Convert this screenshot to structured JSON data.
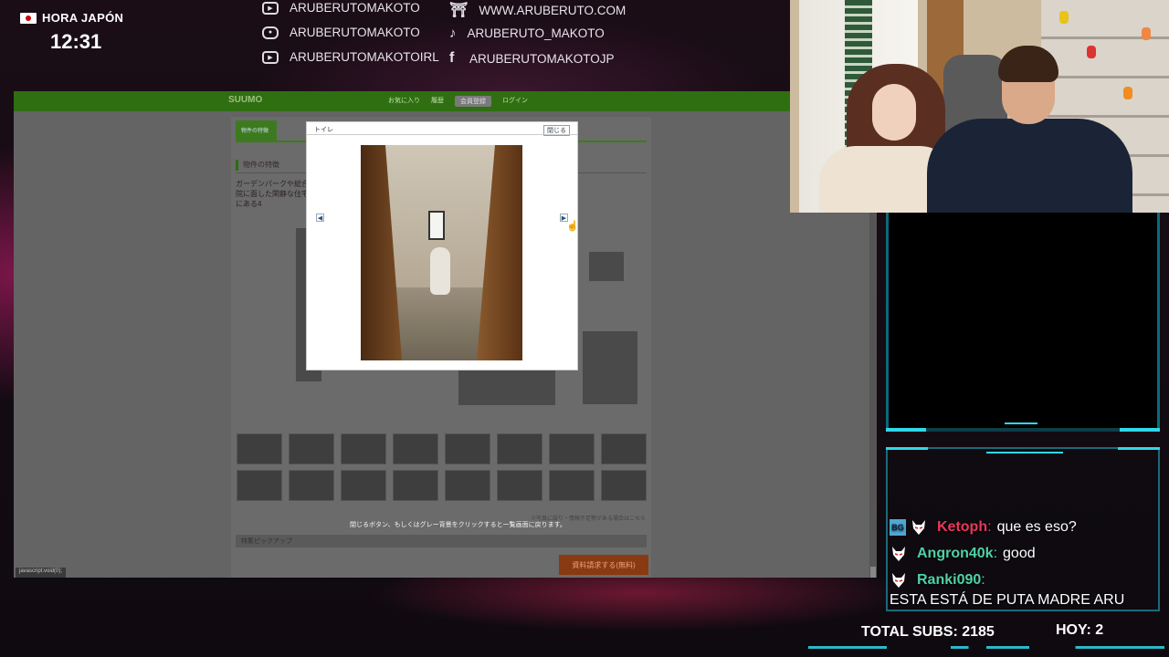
{
  "overlay": {
    "time_label": "HORA JAPÓN",
    "time_value": "12:31",
    "socials": [
      {
        "icon": "youtube-icon",
        "label": "ARUBERUTOMAKOTO"
      },
      {
        "icon": "instagram-icon",
        "label": "ARUBERUTOMAKOTO"
      },
      {
        "icon": "youtube-icon",
        "label": "ARUBERUTOMAKOTOIRL"
      },
      {
        "icon": "torii-icon",
        "label": "WWW.ARUBERUTO.COM"
      },
      {
        "icon": "tiktok-icon",
        "label": "ARUBERUTO_MAKOTO"
      },
      {
        "icon": "facebook-icon",
        "label": "ARUBERUTOMAKOTOJP"
      }
    ],
    "subs_total": "TOTAL SUBS: 2185",
    "subs_today": "HOY: 2"
  },
  "website": {
    "logo": "SUUMO",
    "nav": [
      "お気に入り",
      "履歴",
      "会員登録",
      "ログイン"
    ],
    "tab_label": "物件の特徴",
    "section_title": "物件の特徴",
    "description": "ガーデンパークや総合病院に面した閑静な住宅地にある4",
    "note": "※写真に誤り・情報不足等がある場合はこちら",
    "pickup": "特集ピックアップ",
    "hint": "閉じるボタン、もしくはグレー背景をクリックすると一覧画面に戻ります。",
    "inquiry_button": "資料請求する(無料)",
    "status_bar": "javascript:void(0);"
  },
  "lightbox": {
    "title": "トイレ",
    "close_label": "閉じる",
    "prev_label": "◀",
    "next_label": "▶"
  },
  "chat": {
    "messages": [
      {
        "user": "Ketoph",
        "color": "#e8385a",
        "text": "que es eso?",
        "badge": "BG"
      },
      {
        "user": "Angron40k",
        "color": "#4fd1a5",
        "text": "good"
      },
      {
        "user": "Ranki090",
        "color": "#4fd1a5",
        "text": "ESTA ESTÁ DE PUTA MADRE ARU"
      }
    ]
  },
  "colors": {
    "accent": "#2fd8e8",
    "site_green": "#2f6f12"
  }
}
